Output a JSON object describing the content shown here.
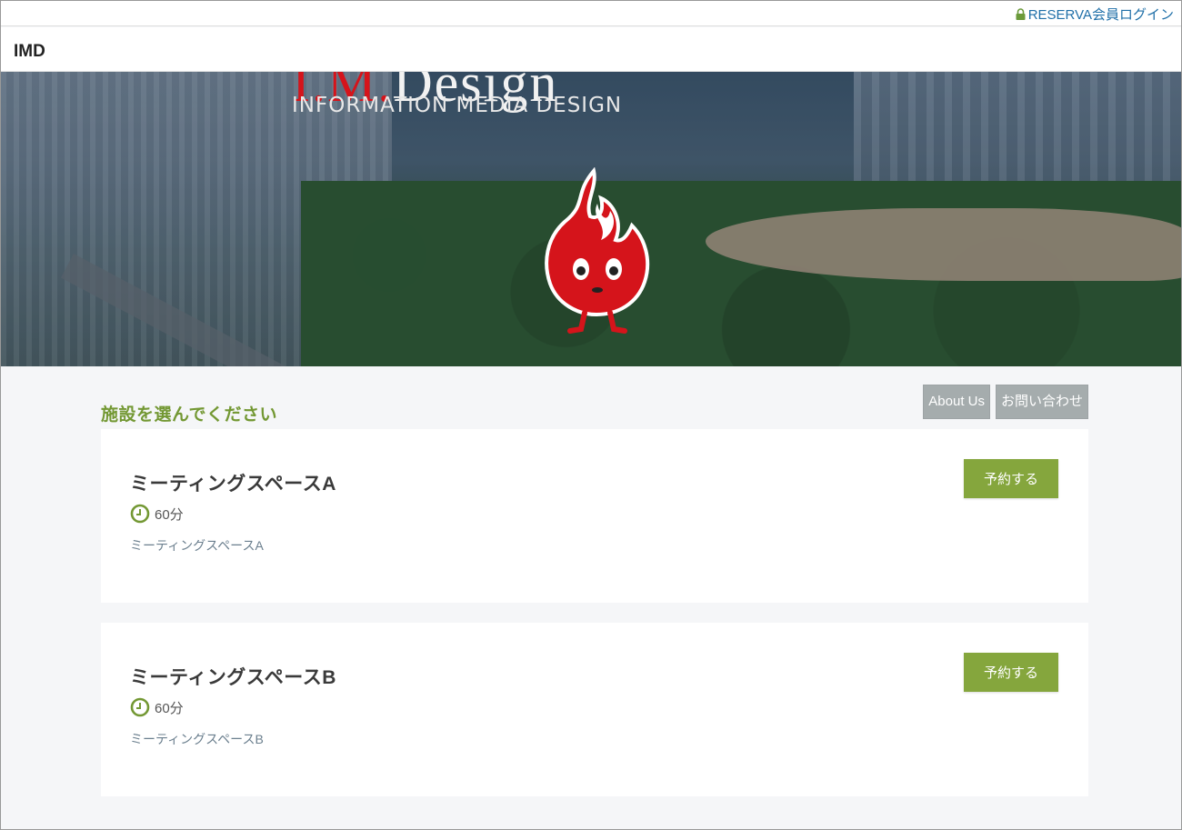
{
  "topbar": {
    "login_label": "RESERVA会員ログイン",
    "login_icon": "lock-icon"
  },
  "header": {
    "brand": "IMD"
  },
  "hero": {
    "logo_text_prefix": "I.M.",
    "logo_text_rest": "Design",
    "tagline": "INFORMATION MEDIA DESIGN",
    "mascot": "flame-mascot"
  },
  "main": {
    "section_title": "施設を選んでください",
    "nav_buttons": [
      "About Us",
      "お問い合わせ"
    ],
    "facilities": [
      {
        "name": "ミーティングスペースA",
        "duration": "60分",
        "description": "ミーティングスペースA",
        "button_label": "予約する"
      },
      {
        "name": "ミーティングスペースB",
        "duration": "60分",
        "description": "ミーティングスペースB",
        "button_label": "予約する"
      }
    ]
  },
  "colors": {
    "accent_green": "#85a63d",
    "title_green": "#739833",
    "link_blue": "#1f6fa8",
    "gray_button": "#a5acad",
    "mascot_red": "#d5141b"
  }
}
